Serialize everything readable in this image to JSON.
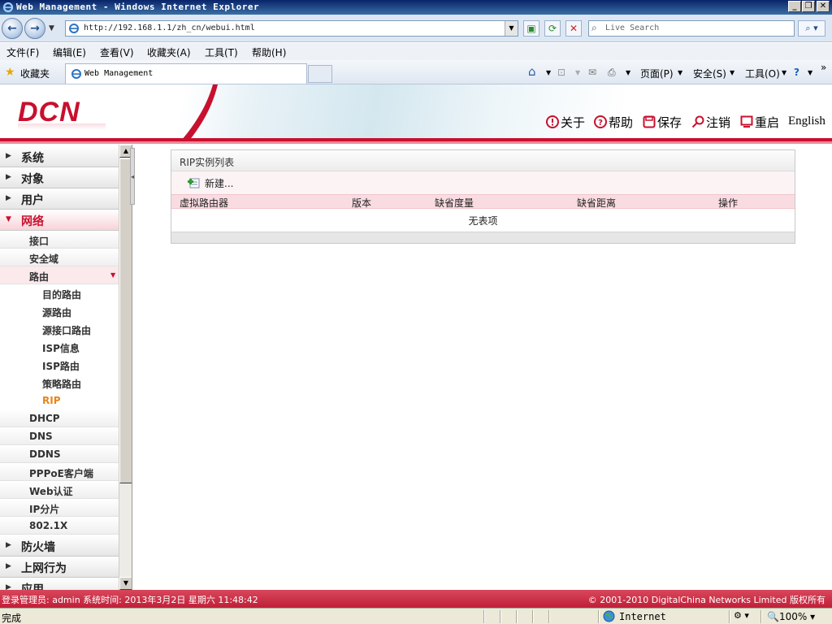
{
  "window": {
    "title": "Web Management - Windows Internet Explorer",
    "min_glyph": "_",
    "max_glyph": "❐",
    "close_glyph": "✕"
  },
  "address_bar": {
    "url": "http://192.168.1.1/zh_cn/webui.html",
    "search_placeholder": "Live Search"
  },
  "menu": {
    "items": [
      "文件(F)",
      "编辑(E)",
      "查看(V)",
      "收藏夹(A)",
      "工具(T)",
      "帮助(H)"
    ]
  },
  "favorites_bar": {
    "favorites_label": "收藏夹",
    "tab_title": "Web Management"
  },
  "command_bar": {
    "page": "页面(P)",
    "safety": "安全(S)",
    "tools": "工具(O)"
  },
  "header": {
    "logo": "DCN",
    "links": [
      "关于",
      "帮助",
      "保存",
      "注销",
      "重启"
    ],
    "language": "English",
    "brand_color": "#c8102e"
  },
  "sidebar": {
    "groups_top": [
      {
        "label": "系统"
      },
      {
        "label": "对象"
      },
      {
        "label": "用户"
      }
    ],
    "network": {
      "label": "网络",
      "items": [
        "接口",
        "安全域"
      ],
      "routing": {
        "label": "路由",
        "items": [
          "目的路由",
          "源路由",
          "源接口路由",
          "ISP信息",
          "ISP路由",
          "策略路由",
          "RIP"
        ],
        "active": "RIP"
      },
      "items_after": [
        "DHCP",
        "DNS",
        "DDNS",
        "PPPoE客户端",
        "Web认证",
        "IP分片",
        "802.1X"
      ]
    },
    "groups_bottom": [
      {
        "label": "防火墙"
      },
      {
        "label": "上网行为"
      },
      {
        "label": "应用"
      }
    ]
  },
  "content": {
    "panel_title": "RIP实例列表",
    "new_button": "新建...",
    "columns": [
      "虚拟路由器",
      "版本",
      "缺省度量",
      "缺省距离",
      "操作"
    ],
    "empty_text": "无表项"
  },
  "footer": {
    "left": "登录管理员: admin 系统时间: 2013年3月2日 星期六 11:48:42",
    "right": "© 2001-2010 DigitalChina Networks Limited 版权所有"
  },
  "status_bar": {
    "status": "完成",
    "zone": "Internet",
    "zoom": "100%"
  }
}
